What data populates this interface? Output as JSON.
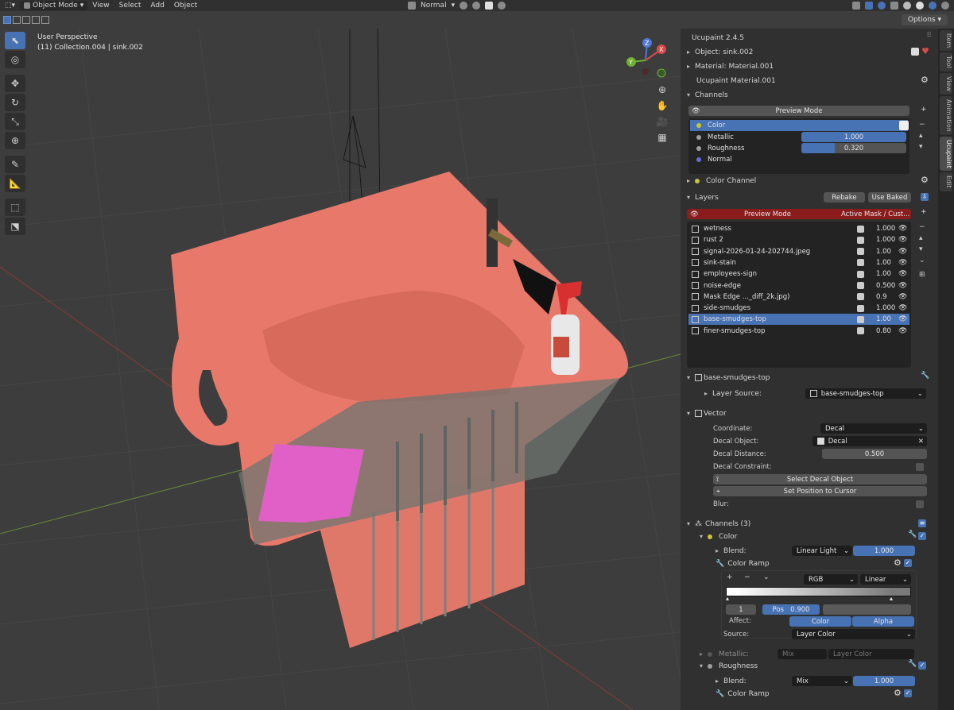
{
  "header": {
    "mode": "Object Mode",
    "menus": [
      "View",
      "Select",
      "Add",
      "Object"
    ],
    "orientation": "Normal",
    "options_label": "Options"
  },
  "viewport": {
    "perspective": "User Perspective",
    "collection": "(11) Collection.004 | sink.002",
    "gizmo_axes": [
      "X",
      "Y",
      "Z"
    ]
  },
  "panel": {
    "addon_title": "Ucupaint 2.4.5",
    "object": "Object: sink.002",
    "material": "Material: Material.001",
    "ucupaint_material": "Ucupaint Material.001",
    "channels_header": "Channels",
    "preview_mode": "Preview Mode",
    "channels": [
      {
        "name": "Color",
        "color": "#c8c53a",
        "value": ""
      },
      {
        "name": "Metallic",
        "color": "#a0a0a0",
        "value": "1.000"
      },
      {
        "name": "Roughness",
        "color": "#a0a0a0",
        "value": "0.320"
      },
      {
        "name": "Normal",
        "color": "#6b6bd6",
        "value": ""
      }
    ],
    "color_channel": "Color Channel",
    "layers_header": "Layers",
    "rebake": "Rebake",
    "use_baked": "Use Baked",
    "layers_preview": "Preview Mode",
    "active_mask": "Active Mask / Cust...",
    "layers": [
      {
        "name": "wetness",
        "value": "1.000"
      },
      {
        "name": "rust 2",
        "value": "1.000"
      },
      {
        "name": "signal-2026-01-24-202744.jpeg",
        "value": "1.00"
      },
      {
        "name": "sink-stain",
        "value": "1.00"
      },
      {
        "name": "employees-sign",
        "value": "1.00"
      },
      {
        "name": "noise-edge",
        "value": "0.500"
      },
      {
        "name": "Mask Edge ..._diff_2k.jpg)",
        "value": "0.9"
      },
      {
        "name": "side-smudges",
        "value": "1.000"
      },
      {
        "name": "base-smudges-top",
        "value": "1.00"
      },
      {
        "name": "finer-smudges-top",
        "value": "0.80"
      }
    ],
    "active_layer": "base-smudges-top",
    "layer_source_label": "Layer Source:",
    "layer_source_value": "base-smudges-top",
    "vector_header": "Vector",
    "coordinate_label": "Coordinate:",
    "coordinate_value": "Decal",
    "decal_object_label": "Decal Object:",
    "decal_object_value": "Decal",
    "decal_distance_label": "Decal Distance:",
    "decal_distance_value": "0.500",
    "decal_constraint_label": "Decal Constraint:",
    "select_decal": "Select Decal Object",
    "set_position": "Set Position to Cursor",
    "blur_label": "Blur:",
    "channels3_header": "Channels (3)",
    "ch_color": "Color",
    "blend_label": "Blend:",
    "blend_value": "Linear Light",
    "blend_amount": "1.000",
    "color_ramp": "Color Ramp",
    "ramp_mode": "RGB",
    "ramp_interp": "Linear",
    "ramp_index": "1",
    "ramp_pos_label": "Pos",
    "ramp_pos_value": "0.900",
    "affect_label": "Affect:",
    "affect_color": "Color",
    "affect_alpha": "Alpha",
    "source_label": "Source:",
    "source_value": "Layer Color",
    "metallic_label": "Metallic:",
    "metallic_blend": "Mix",
    "metallic_source": "Layer Color",
    "ch_roughness": "Roughness",
    "blend2_value": "Mix",
    "blend2_amount": "1.000",
    "color_ramp2": "Color Ramp"
  },
  "tabs": [
    "Item",
    "Tool",
    "View",
    "Animation",
    "Ucupaint",
    "Edit"
  ]
}
